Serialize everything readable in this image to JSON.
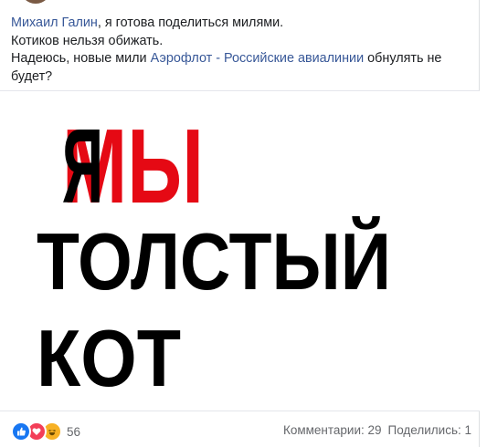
{
  "post": {
    "line1_link": "Михаил Галин",
    "line1_rest": ", я готова поделиться милями.",
    "line2": "Котиков нельзя обижать.",
    "line3_pre": "Надеюсь, новые мили ",
    "line3_link": "Аэрофлот - Российские авиалинии",
    "line3_post": " обнулять не",
    "line4": "будет?"
  },
  "meme": {
    "letter_ya": "Я",
    "word_my": "МЫ",
    "word_tolstyy": "ТОЛСТЫЙ",
    "word_kot": "КОТ",
    "colors": {
      "red": "#e50914",
      "black": "#000000"
    }
  },
  "footer": {
    "reactions": [
      "like-icon",
      "love-icon",
      "haha-icon"
    ],
    "reactions_count": "56",
    "comments": "Комментарии: 29",
    "shares": "Поделились: 1"
  }
}
